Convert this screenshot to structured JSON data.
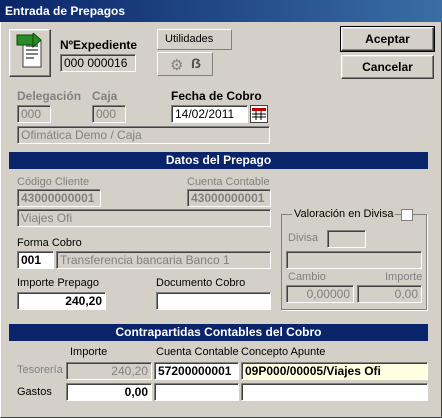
{
  "window": {
    "title": "Entrada de Prepagos"
  },
  "header": {
    "expediente_label": "NºExpediente",
    "expediente_value": "000 000016",
    "utilidades_label": "Utilidades",
    "aceptar_label": "Aceptar",
    "cancelar_label": "Cancelar"
  },
  "top": {
    "delegacion_label": "Delegación",
    "delegacion_value": "000",
    "caja_label": "Caja",
    "caja_value": "000",
    "fecha_label": "Fecha de Cobro",
    "fecha_value": "14/02/2011",
    "caja_desc": "Ofimática Demo / Caja"
  },
  "datos": {
    "title": "Datos del Prepago",
    "codigo_cliente_label": "Código Cliente",
    "codigo_cliente_value": "43000000001",
    "cuenta_contable_label": "Cuenta Contable",
    "cuenta_contable_value": "43000000001",
    "cliente_nombre": "Viajes Ofi",
    "forma_cobro_label": "Forma Cobro",
    "forma_cobro_code": "001",
    "forma_cobro_desc": "Transferencia bancaria Banco 1",
    "importe_label": "Importe Prepago",
    "importe_value": "240,20",
    "documento_label": "Documento Cobro",
    "documento_value": ""
  },
  "divisa": {
    "group_label": "Valoración en Divisa",
    "divisa_label": "Divisa",
    "divisa_value": "",
    "divisa_desc": "",
    "cambio_label": "Cambio",
    "cambio_value": "0,00000",
    "importe_label": "Importe",
    "importe_value": "0,00"
  },
  "contrapartidas": {
    "title": "Contrapartidas Contables del Cobro",
    "col_importe": "Importe",
    "col_cuenta": "Cuenta Contable",
    "col_concepto": "Concepto Apunte",
    "row1_label": "Tesorería",
    "row1_importe": "240,20",
    "row1_cuenta": "57200000001",
    "row1_concepto": "09P000/00005/Viajes Ofi",
    "row2_label": "Gastos",
    "row2_importe": "0,00",
    "row2_cuenta": "",
    "row2_concepto": ""
  },
  "colors": {
    "title_bar": "#0a246a",
    "section_bar": "#0a246a",
    "face": "#d4d0c8",
    "highlight_field": "#ffffe1"
  }
}
